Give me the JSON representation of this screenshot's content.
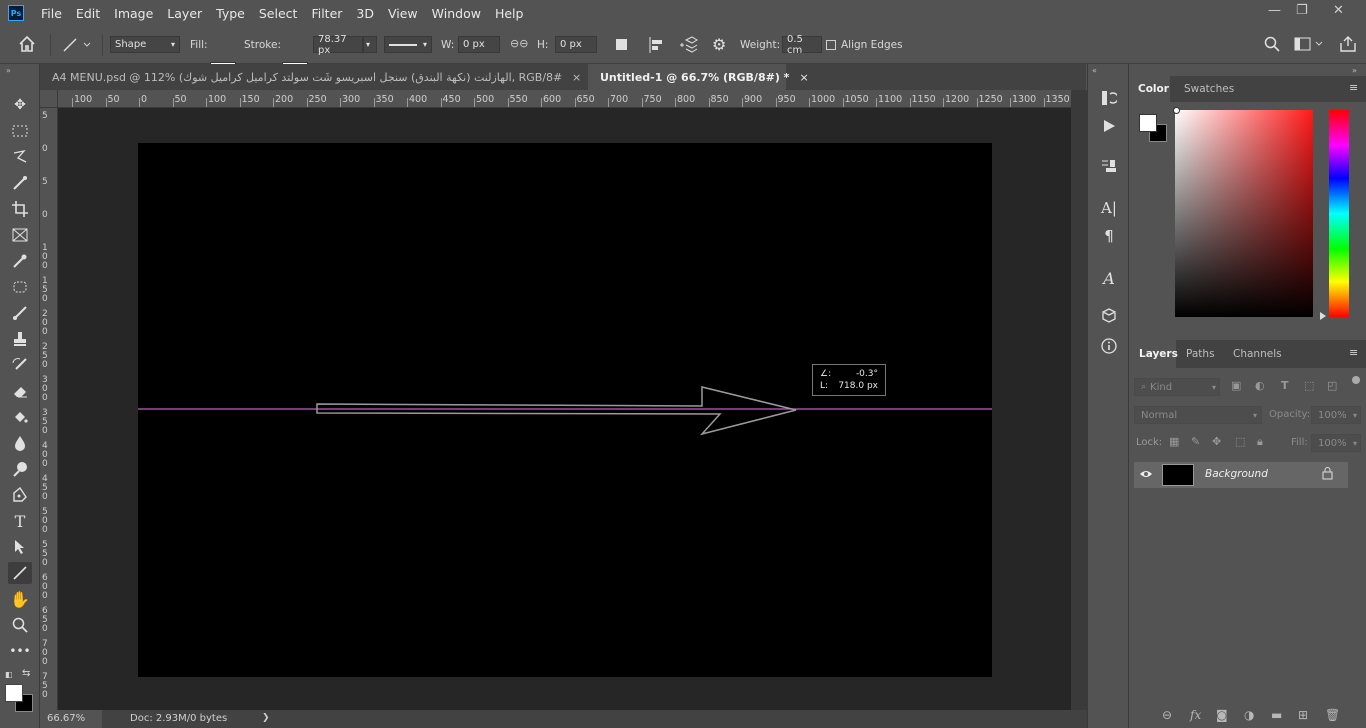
{
  "app": {
    "logo": "Ps"
  },
  "menu": [
    "File",
    "Edit",
    "Image",
    "Layer",
    "Type",
    "Select",
    "Filter",
    "3D",
    "View",
    "Window",
    "Help"
  ],
  "window_controls": {
    "minimize": "—",
    "restore": "❐",
    "close": "✕"
  },
  "options": {
    "mode": "Shape",
    "fill_label": "Fill:",
    "stroke_label": "Stroke:",
    "stroke_width": "78.37 px",
    "w_label": "W:",
    "w_value": "0 px",
    "h_label": "H:",
    "h_value": "0 px",
    "weight_label": "Weight:",
    "weight_value": "0.5 cm",
    "align_edges": "Align Edges"
  },
  "tabs": [
    {
      "label": "A4 MENU.psd @ 112% (الهازلنت (نكهة البندق) سنجل اسبريسو شَت سولتد كراميل كراميل شوك, RGB/8#) *",
      "close": "×"
    },
    {
      "label": "Untitled-1 @ 66.7% (RGB/8#) *",
      "close": "×"
    }
  ],
  "ruler": {
    "h": [
      "100",
      "50",
      "0",
      "50",
      "100",
      "150",
      "200",
      "250",
      "300",
      "350",
      "400",
      "450",
      "500",
      "550",
      "600",
      "650",
      "700",
      "750",
      "800",
      "850",
      "900",
      "950",
      "1000",
      "1050",
      "1100",
      "1150",
      "1200",
      "1250",
      "1300",
      "1350"
    ],
    "v": [
      "5",
      "0",
      "5",
      "0",
      "1 0 0",
      "1 5 0",
      "2 0 0",
      "2 5 0",
      "3 0 0",
      "3 5 0",
      "4 0 0",
      "4 5 0",
      "5 0 0",
      "5 5 0",
      "6 0 0",
      "6 5 0",
      "7 0 0",
      "7 5 0"
    ]
  },
  "tooltip": {
    "angle_label": "∠:",
    "angle": "-0.3°",
    "length_label": "L:",
    "length": "718.0 px"
  },
  "status": {
    "zoom": "66.67%",
    "doc": "Doc: 2.93M/0 bytes",
    "arrow": "❯"
  },
  "panels": {
    "color_tabs": [
      "Color",
      "Swatches"
    ],
    "layer_tabs": [
      "Layers",
      "Paths",
      "Channels"
    ],
    "kind": "Kind",
    "blend": "Normal",
    "opacity_label": "Opacity:",
    "opacity": "100%",
    "lock_label": "Lock:",
    "fill_label": "Fill:",
    "fill": "100%",
    "layer_name": "Background"
  },
  "colors": {
    "guide": "#c060c0",
    "accent": "#31a8ff"
  }
}
